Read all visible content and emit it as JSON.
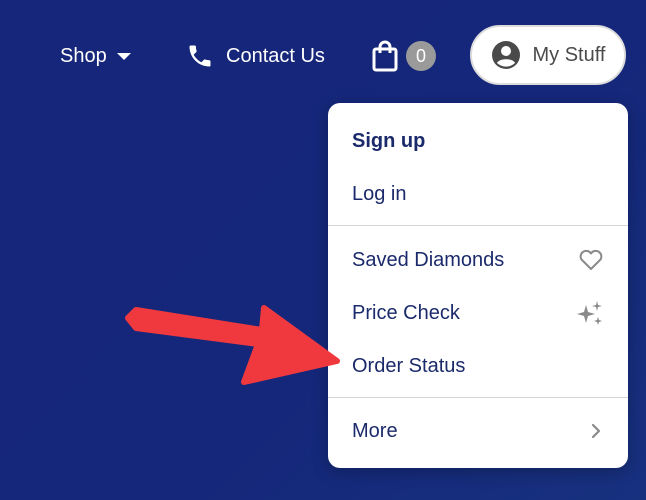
{
  "header": {
    "shop_label": "Shop",
    "contact_label": "Contact Us",
    "cart_count": "0",
    "account_label": "My Stuff"
  },
  "menu": {
    "sign_up": "Sign up",
    "log_in": "Log in",
    "saved_diamonds": "Saved Diamonds",
    "price_check": "Price Check",
    "order_status": "Order Status",
    "more": "More"
  },
  "colors": {
    "background": "#15277a",
    "menu_text": "#1b2a6b",
    "arrow": "#f0393f"
  },
  "icons": [
    "chevron-down-icon",
    "phone-icon",
    "shopping-bag-icon",
    "user-circle-icon",
    "heart-icon",
    "sparkle-icon",
    "chevron-right-icon"
  ]
}
